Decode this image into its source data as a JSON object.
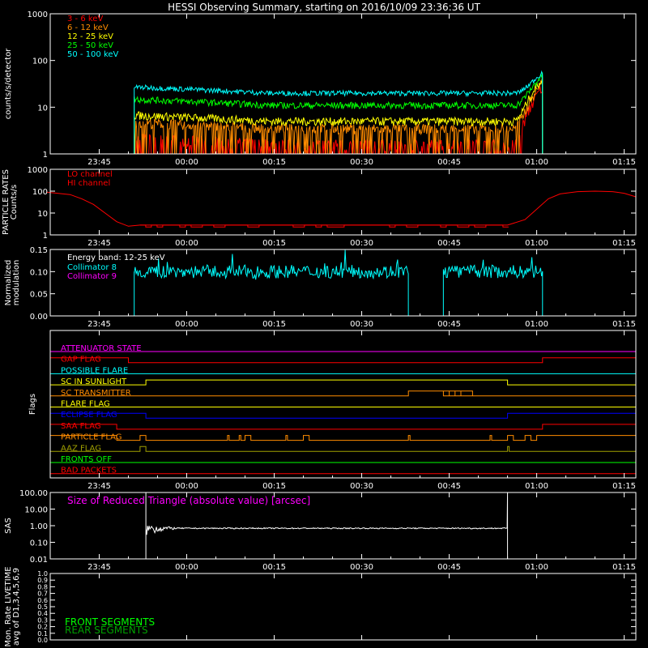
{
  "title": "HESSI Observing Summary, starting on 2016/10/09 23:36:36 UT",
  "colors": {
    "background": "#000000",
    "foreground": "#ffffff",
    "red": "#ff0000",
    "orange": "#ff8c00",
    "yellow": "#ffff00",
    "green": "#00ff00",
    "cyan": "#00ffff",
    "magenta": "#ff00ff",
    "blue": "#0000ff",
    "olive": "#a0a000",
    "front_green": "#00ff00",
    "rear_green": "#00a000"
  },
  "time_ticks": [
    "23:45",
    "00:00",
    "00:15",
    "00:30",
    "00:45",
    "01:00",
    "01:15"
  ],
  "chart_data": [
    {
      "type": "line",
      "id": "count_rates",
      "ylabel": "counts/s/detector",
      "yscale": "log",
      "ylim": [
        1,
        1000
      ],
      "y_ticks": [
        "1",
        "10",
        "100",
        "1000"
      ],
      "x_range": [
        "23:36:36",
        "01:17:00"
      ],
      "series": [
        {
          "name": "3 - 6 keV",
          "color": "#ff0000",
          "level": 1.6
        },
        {
          "name": "6 - 12 keV",
          "color": "#ff8c00",
          "level": 3.5
        },
        {
          "name": "12 - 25 keV",
          "color": "#ffff00",
          "level": 5
        },
        {
          "name": "25 - 50 keV",
          "color": "#00ff00",
          "level": 11
        },
        {
          "name": "50 - 100 keV",
          "color": "#00ffff",
          "level": 20
        }
      ],
      "active_interval": [
        "23:51",
        "01:01"
      ],
      "end_peak": {
        "time": "01:01",
        "value": 60
      }
    },
    {
      "type": "line",
      "id": "particle_rates",
      "ylabel": [
        "PARTICLE RATES",
        "Counts/s"
      ],
      "yscale": "log",
      "ylim": [
        1,
        1000
      ],
      "y_ticks": [
        "1",
        "10",
        "100",
        "1000"
      ],
      "series": [
        {
          "name": "LO channel",
          "color": "#ff0000"
        },
        {
          "name": "HI channel",
          "color": "#ff0000"
        }
      ],
      "lo_channel": {
        "x": [
          "23:36",
          "23:40",
          "23:42",
          "23:44",
          "23:46",
          "23:48",
          "23:50",
          "23:52",
          "00:55",
          "00:58",
          "01:00",
          "01:02",
          "01:04",
          "01:07",
          "01:10",
          "01:13",
          "01:15",
          "01:17"
        ],
        "y": [
          90,
          70,
          45,
          25,
          10,
          4,
          2.5,
          2.8,
          2.8,
          5,
          15,
          45,
          75,
          95,
          100,
          95,
          80,
          55
        ]
      },
      "hi_channel_value": 1
    },
    {
      "type": "line",
      "id": "modulation",
      "ylabel": [
        "Normalized",
        "modulation"
      ],
      "ylim": [
        0,
        0.15
      ],
      "y_ticks": [
        "0.00",
        "0.05",
        "0.10",
        "0.15"
      ],
      "annotation": "Energy band: 12-25 keV",
      "series": [
        {
          "name": "Collimator 8",
          "color": "#00ffff",
          "level": 0.1,
          "segments": [
            [
              "23:51",
              "00:38"
            ],
            [
              "00:44",
              "01:01"
            ]
          ]
        },
        {
          "name": "Collimator 9",
          "color": "#ff00ff",
          "level": 0
        }
      ]
    },
    {
      "type": "line",
      "id": "flags",
      "ylabel": "Flags",
      "flags": [
        {
          "name": "ATTENUATOR STATE",
          "color": "#ff00ff",
          "high": []
        },
        {
          "name": "GAP FLAG",
          "color": "#ff0000",
          "high": [
            [
              "23:36",
              "23:50"
            ],
            [
              "01:01",
              "01:17"
            ]
          ]
        },
        {
          "name": "POSSIBLE FLARE",
          "color": "#00ffff",
          "high": []
        },
        {
          "name": "SC IN SUNLIGHT",
          "color": "#ffff00",
          "high": [
            [
              "23:53",
              "00:55"
            ]
          ]
        },
        {
          "name": "SC TRANSMITTER",
          "color": "#ff8c00",
          "high": [
            [
              "00:38",
              "00:49"
            ],
            [
              "00:44",
              "00:45"
            ],
            [
              "00:46",
              "00:47"
            ]
          ]
        },
        {
          "name": "FLARE FLAG",
          "color": "#ffff00",
          "high": []
        },
        {
          "name": "ECLIPSE FLAG",
          "color": "#0000ff",
          "high": [
            [
              "23:36",
              "23:53"
            ],
            [
              "00:55",
              "01:17"
            ]
          ]
        },
        {
          "name": "SAA FLAG",
          "color": "#ff0000",
          "high": [
            [
              "23:36",
              "23:48"
            ],
            [
              "01:01",
              "01:17"
            ]
          ]
        },
        {
          "name": "PARTICLE FLAG",
          "color": "#ff8c00",
          "high": [
            [
              "23:36",
              "23:48"
            ],
            [
              "23:52",
              "23:53"
            ],
            [
              "00:07",
              "00:07"
            ],
            [
              "00:09",
              "00:09"
            ],
            [
              "00:10",
              "00:11"
            ],
            [
              "00:17",
              "00:17"
            ],
            [
              "00:20",
              "00:21"
            ],
            [
              "00:38",
              "00:38"
            ],
            [
              "00:52",
              "00:52"
            ],
            [
              "00:55",
              "00:56"
            ],
            [
              "00:58",
              "00:59"
            ],
            [
              "01:00",
              "01:17"
            ]
          ]
        },
        {
          "name": "AAZ FLAG",
          "color": "#a0a000",
          "high": [
            [
              "23:52",
              "23:53"
            ],
            [
              "00:55",
              "00:55"
            ]
          ]
        },
        {
          "name": "FRONTS OFF",
          "color": "#00ff00",
          "high": []
        },
        {
          "name": "BAD PACKETS",
          "color": "#ff0000",
          "high": []
        }
      ]
    },
    {
      "type": "line",
      "id": "sas",
      "ylabel": "SAS",
      "yscale": "log",
      "ylim": [
        0.01,
        100
      ],
      "y_ticks": [
        "0.01",
        "0.10",
        "1.00",
        "10.00",
        "100.00"
      ],
      "annotation": "Size of Reduced Triangle (absolute value) [arcsec]",
      "series": [
        {
          "name": "Size of Reduced Triangle",
          "color": "#ffffff",
          "level": 0.7
        }
      ],
      "active_interval": [
        "23:53",
        "00:55"
      ]
    },
    {
      "type": "line",
      "id": "livetime",
      "ylabel": [
        "Mon. Rate LIVETIME",
        "avg of D1,3,4,5,6,9"
      ],
      "ylim": [
        0,
        1
      ],
      "y_ticks": [
        "0.0",
        "0.1",
        "0.2",
        "0.3",
        "0.4",
        "0.5",
        "0.6",
        "0.7",
        "0.8",
        "0.9",
        "1.0"
      ],
      "series": [
        {
          "name": "FRONT SEGMENTS",
          "color": "#00ff00"
        },
        {
          "name": "REAR SEGMENTS",
          "color": "#00a000"
        }
      ]
    }
  ]
}
